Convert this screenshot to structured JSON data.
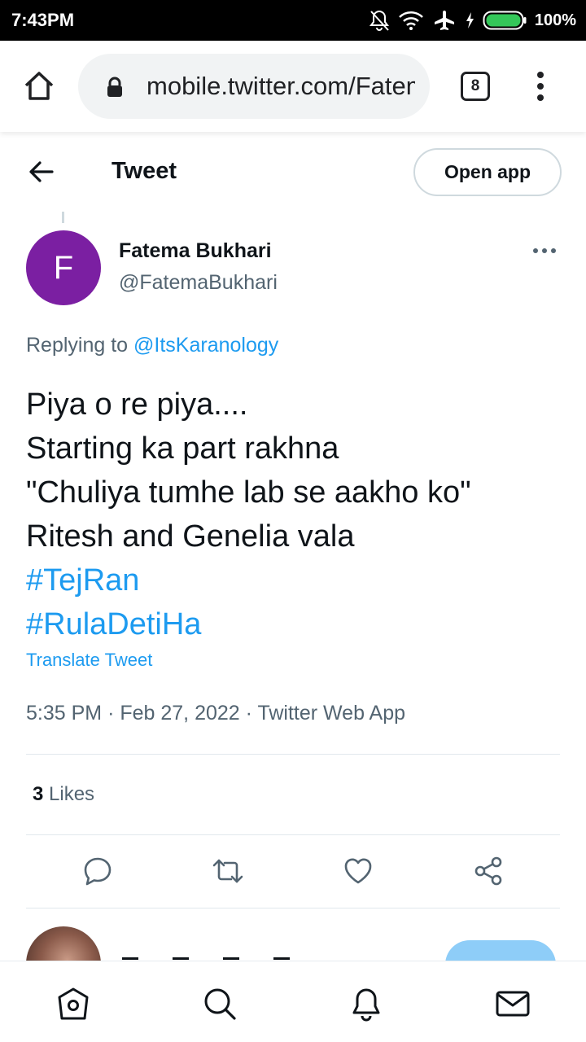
{
  "status_bar": {
    "time": "7:43PM",
    "battery_percent": "100%",
    "icons": [
      "notifications-off-icon",
      "wifi-icon",
      "airplane-mode-icon",
      "charging-icon",
      "battery-icon"
    ]
  },
  "browser": {
    "url": "mobile.twitter.com/FatemaBukhari",
    "tab_count": "8"
  },
  "header": {
    "title": "Tweet",
    "open_app_label": "Open app"
  },
  "tweet": {
    "author": {
      "avatar_initial": "F",
      "avatar_color": "#7b1fa2",
      "display_name": "Fatema Bukhari",
      "handle": "@FatemaBukhari"
    },
    "replying_to_prefix": "Replying to",
    "replying_to_handle": "@ItsKaranology",
    "body_lines": [
      "Piya o re piya....",
      "Starting ka part rakhna",
      "\"Chuliya tumhe lab se aakho ko\"",
      "Ritesh and Genelia vala"
    ],
    "hashtags": [
      "#TejRan",
      "#RulaDetiHa"
    ],
    "translate_label": "Translate Tweet",
    "time": "5:35 PM",
    "date": "Feb 27, 2022",
    "source": "Twitter Web App",
    "meta_separator": "·",
    "likes_count": "3",
    "likes_label": "Likes"
  },
  "colors": {
    "accent": "#1d9bf0",
    "text_primary": "#0f1419",
    "text_secondary": "#536471"
  }
}
